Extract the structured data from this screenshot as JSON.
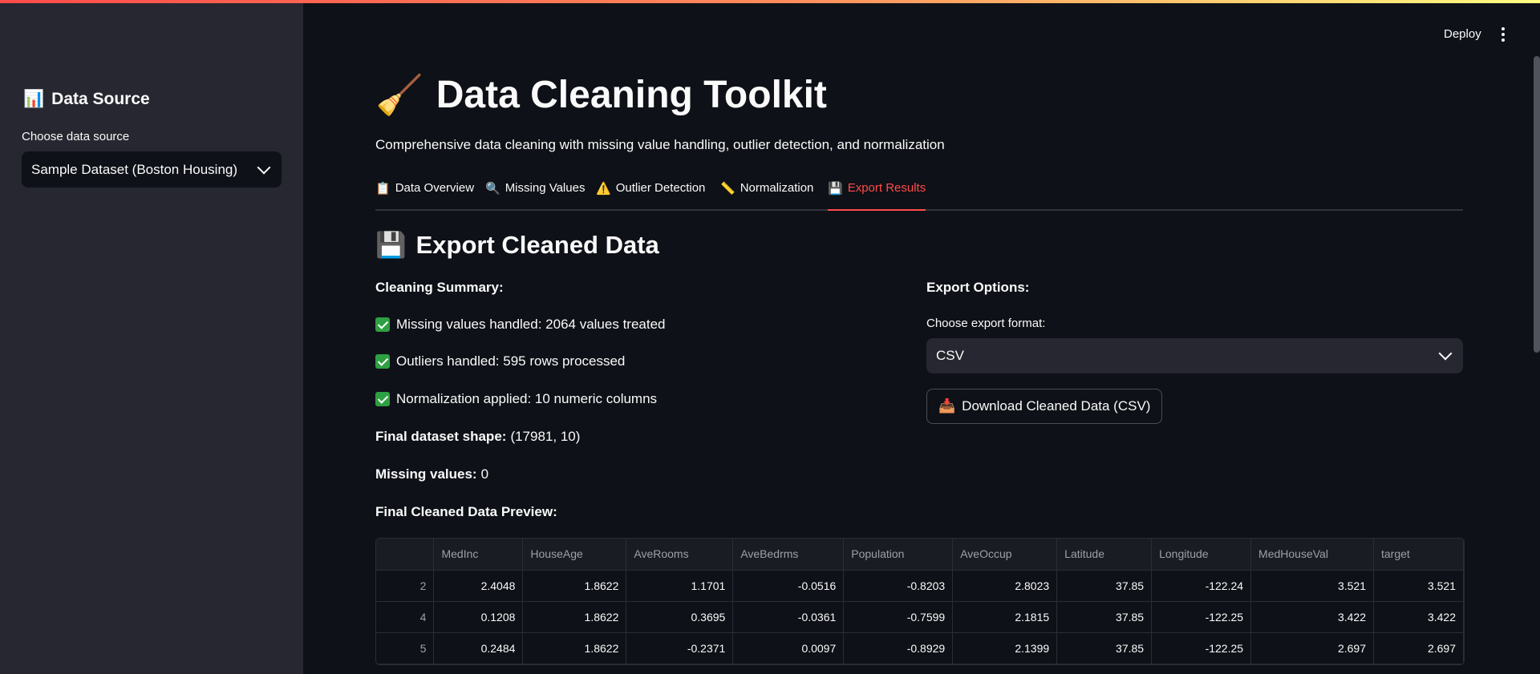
{
  "header": {
    "deploy_label": "Deploy"
  },
  "sidebar": {
    "title": "Data Source",
    "title_icon": "📊",
    "select_label": "Choose data source",
    "select_value": "Sample Dataset (Boston Housing)"
  },
  "main": {
    "title": "Data Cleaning Toolkit",
    "title_icon": "🧹",
    "subtitle": "Comprehensive data cleaning with missing value handling, outlier detection, and normalization",
    "tabs": [
      {
        "icon": "📋",
        "label": "Data Overview"
      },
      {
        "icon": "🔍",
        "label": "Missing Values"
      },
      {
        "icon": "⚠️",
        "label": "Outlier Detection"
      },
      {
        "icon": "📏",
        "label": "Normalization"
      },
      {
        "icon": "💾",
        "label": "Export Results"
      }
    ],
    "active_tab": "Export Results",
    "section_title": "Export Cleaned Data",
    "section_icon": "💾",
    "summary": {
      "heading": "Cleaning Summary:",
      "items": [
        "Missing values handled: 2064 values treated",
        "Outliers handled: 595 rows processed",
        "Normalization applied: 10 numeric columns"
      ],
      "shape_label": "Final dataset shape:",
      "shape_value": "(17981, 10)",
      "missing_label": "Missing values:",
      "missing_value": "0",
      "preview_heading": "Final Cleaned Data Preview:"
    },
    "export": {
      "heading": "Export Options:",
      "format_label": "Choose export format:",
      "format_value": "CSV",
      "download_icon": "📥",
      "download_label": "Download Cleaned Data (CSV)"
    },
    "table": {
      "columns": [
        "",
        "MedInc",
        "HouseAge",
        "AveRooms",
        "AveBedrms",
        "Population",
        "AveOccup",
        "Latitude",
        "Longitude",
        "MedHouseVal",
        "target"
      ],
      "rows": [
        [
          "2",
          "2.4048",
          "1.8622",
          "1.1701",
          "-0.0516",
          "-0.8203",
          "2.8023",
          "37.85",
          "-122.24",
          "3.521",
          "3.521"
        ],
        [
          "4",
          "0.1208",
          "1.8622",
          "0.3695",
          "-0.0361",
          "-0.7599",
          "2.1815",
          "37.85",
          "-122.25",
          "3.422",
          "3.422"
        ],
        [
          "5",
          "0.2484",
          "1.8622",
          "-0.2371",
          "0.0097",
          "-0.8929",
          "2.1399",
          "37.85",
          "-122.25",
          "2.697",
          "2.697"
        ]
      ]
    }
  },
  "colors": {
    "accent": "#ff4b4b",
    "background": "#0e1117",
    "sidebar": "#262730"
  }
}
